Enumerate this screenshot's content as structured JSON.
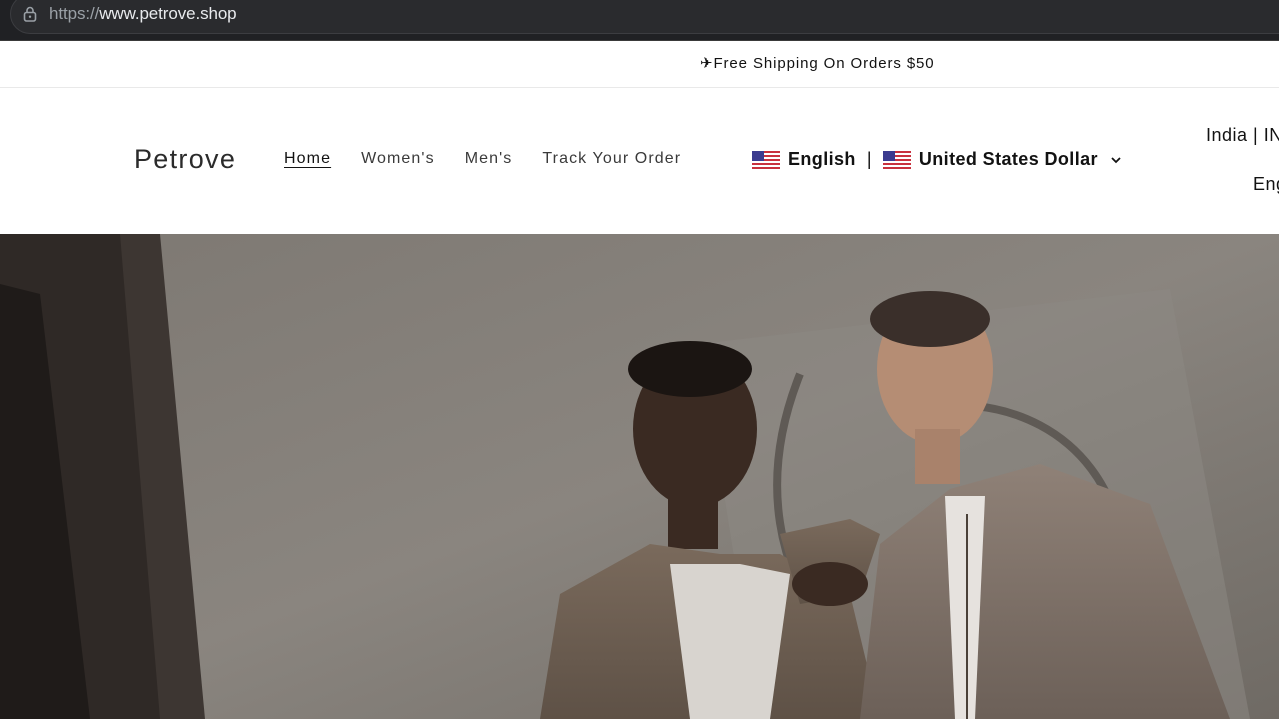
{
  "browser": {
    "url_prefix": "https://",
    "url_rest": "www.petrove.shop",
    "lock_icon": "lock-icon"
  },
  "announcement": {
    "text": "✈Free Shipping On Orders $50"
  },
  "header": {
    "logo": "Petrove",
    "nav": [
      {
        "label": "Home",
        "active": true
      },
      {
        "label": "Women's",
        "active": false
      },
      {
        "label": "Men's",
        "active": false
      },
      {
        "label": "Track Your Order",
        "active": false
      }
    ],
    "language": "English",
    "separator": "|",
    "currency": "United States Dollar",
    "region_line1": "India | IN",
    "region_line2": "Eng"
  },
  "hero": {
    "image": "two-men-fashion-photo"
  }
}
